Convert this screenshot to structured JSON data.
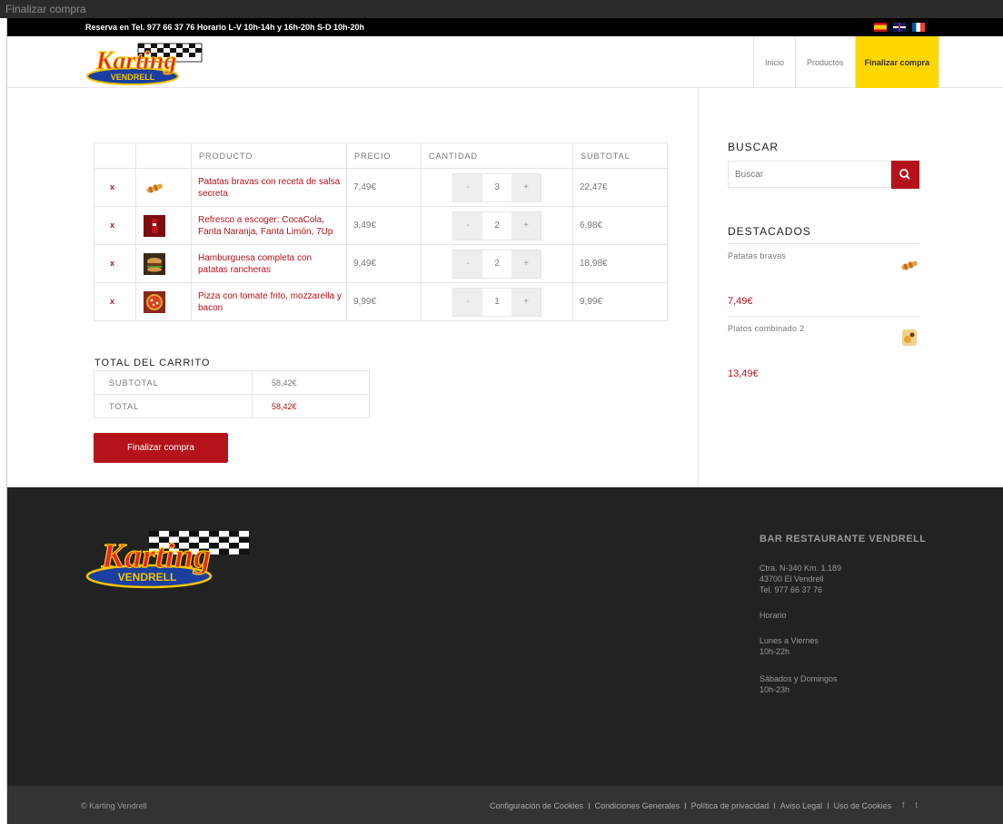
{
  "window": {
    "title": "Finalizar compra"
  },
  "topbar": {
    "info": "Reserva en Tel. 977 66 37 76 Horario L-V 10h-14h y 16h-20h S-D 10h-20h"
  },
  "nav": {
    "items": [
      {
        "label": "Inicio"
      },
      {
        "label": "Productos"
      },
      {
        "label": "Finalizar compra"
      }
    ]
  },
  "cart": {
    "headers": {
      "product": "PRODUCTO",
      "price": "PRECIO",
      "quantity": "CANTIDAD",
      "subtotal": "SUBTOTAL"
    },
    "minus": "-",
    "plus": "+",
    "remove": "x",
    "rows": [
      {
        "product": "Patatas bravas con receta de salsa secreta",
        "price": "7,49€",
        "qty": "3",
        "subtotal": "22,47€"
      },
      {
        "product": "Refresco a escoger: CocaCola, Fanta Naranja, Fanta Limón, 7Up",
        "price": "3,49€",
        "qty": "2",
        "subtotal": "6,98€"
      },
      {
        "product": "Hamburguesa completa con patatas rancheras",
        "price": "9,49€",
        "qty": "2",
        "subtotal": "18,98€"
      },
      {
        "product": "Pizza  con tomate frito, mozzarella y bacon",
        "price": "9,99€",
        "qty": "1",
        "subtotal": "9,99€"
      }
    ]
  },
  "totals": {
    "title": "TOTAL DEL CARRITO",
    "subtotal_label": "SUBTOTAL",
    "subtotal_value": "58,42€",
    "total_label": "TOTAL",
    "total_value": "58,42€"
  },
  "checkout_button": "Finalizar compra",
  "sidebar": {
    "search_title": "BUSCAR",
    "search_placeholder": "Buscar",
    "featured_title": "DESTACADOS",
    "featured": [
      {
        "name": "Patatas bravas",
        "price": "7,49€"
      },
      {
        "name": "Platos combinado 2",
        "price": "13,49€"
      }
    ]
  },
  "footer": {
    "title": "BAR RESTAURANTE VENDRELL",
    "address": "Ctra. N-340 Km. 1.189\n43700 El Vendrell\nTel. 977 66 37 76",
    "schedule_label": "Horario",
    "weekdays": "Lunes a Viernes\n10h-22h",
    "weekend": "Sábados y Domingos\n10h-23h",
    "copyright": "© Karting Vendrell",
    "links": [
      "Configuración de Cookies",
      "Condiciones Generales",
      "Política de privacidad",
      "Aviso Legal",
      "Uso de Cookies"
    ],
    "link_separator": "I",
    "social": [
      "f",
      "t"
    ]
  },
  "logo_text": {
    "main": "Karting",
    "sub": "VENDRELL"
  },
  "colors": {
    "accent": "#b5121b",
    "nav_active": "#ffd700",
    "footer_bg": "#222222",
    "bottombar_bg": "#333333"
  },
  "icons": [
    "search-icon",
    "remove-icon",
    "flag-es-icon",
    "flag-uk-icon",
    "flag-fr-icon",
    "facebook-icon",
    "twitter-icon"
  ]
}
